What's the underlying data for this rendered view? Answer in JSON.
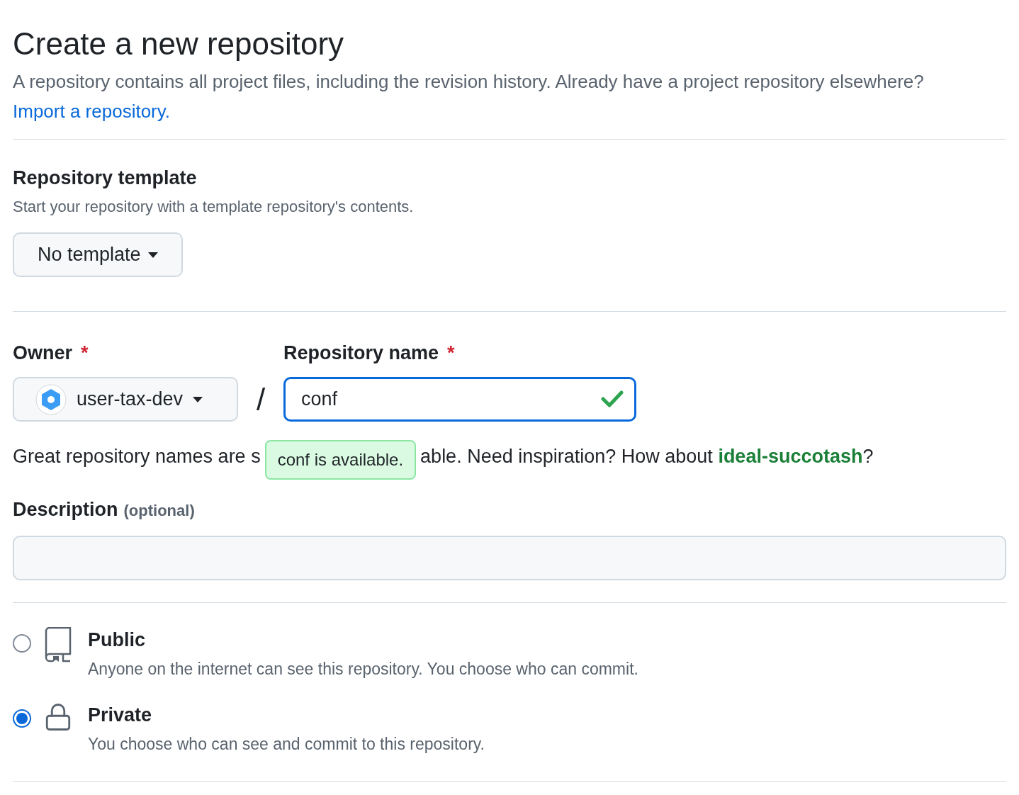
{
  "header": {
    "title": "Create a new repository",
    "intro": "A repository contains all project files, including the revision history. Already have a project repository elsewhere?",
    "import_link": "Import a repository."
  },
  "template": {
    "label": "Repository template",
    "hint": "Start your repository with a template repository's contents.",
    "button": "No template"
  },
  "owner": {
    "label": "Owner",
    "required_mark": "*",
    "value": "user-tax-dev"
  },
  "separator": "/",
  "repo_name": {
    "label": "Repository name",
    "required_mark": "*",
    "value": "conf",
    "valid": true
  },
  "tooltip": "conf is available.",
  "name_hint": {
    "before": "Great repository names are s",
    "after": "able. Need inspiration? How about",
    "suggestion": "ideal-succotash",
    "end": "?"
  },
  "description": {
    "label": "Description",
    "optional": "(optional)"
  },
  "visibility": [
    {
      "kind": "public",
      "title": "Public",
      "text": "Anyone on the internet can see this repository. You choose who can commit.",
      "selected": false
    },
    {
      "kind": "private",
      "title": "Private",
      "text": "You choose who can see and commit to this repository.",
      "selected": true
    }
  ]
}
